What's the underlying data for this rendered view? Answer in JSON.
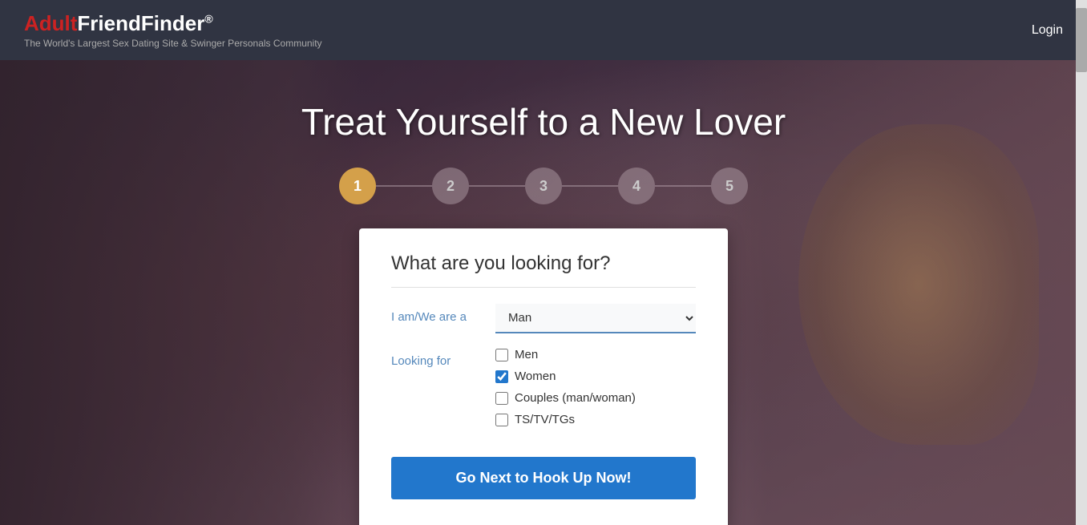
{
  "header": {
    "logo_adult": "Adult",
    "logo_friend": "FriendFinder",
    "logo_registered": "®",
    "tagline": "The World's Largest Sex Dating Site & Swinger Personals Community",
    "login_label": "Login"
  },
  "hero": {
    "title": "Treat Yourself to a New Lover"
  },
  "steps": [
    {
      "number": "1",
      "active": true
    },
    {
      "number": "2",
      "active": false
    },
    {
      "number": "3",
      "active": false
    },
    {
      "number": "4",
      "active": false
    },
    {
      "number": "5",
      "active": false
    }
  ],
  "form": {
    "title": "What are you looking for?",
    "iam_label": "I am/We are a",
    "iam_value": "Man",
    "looking_for_label": "Looking for",
    "checkboxes": [
      {
        "label": "Men",
        "checked": false
      },
      {
        "label": "Women",
        "checked": true
      },
      {
        "label": "Couples (man/woman)",
        "checked": false
      },
      {
        "label": "TS/TV/TGs",
        "checked": false
      }
    ],
    "submit_button": "Go Next to Hook Up Now!"
  }
}
